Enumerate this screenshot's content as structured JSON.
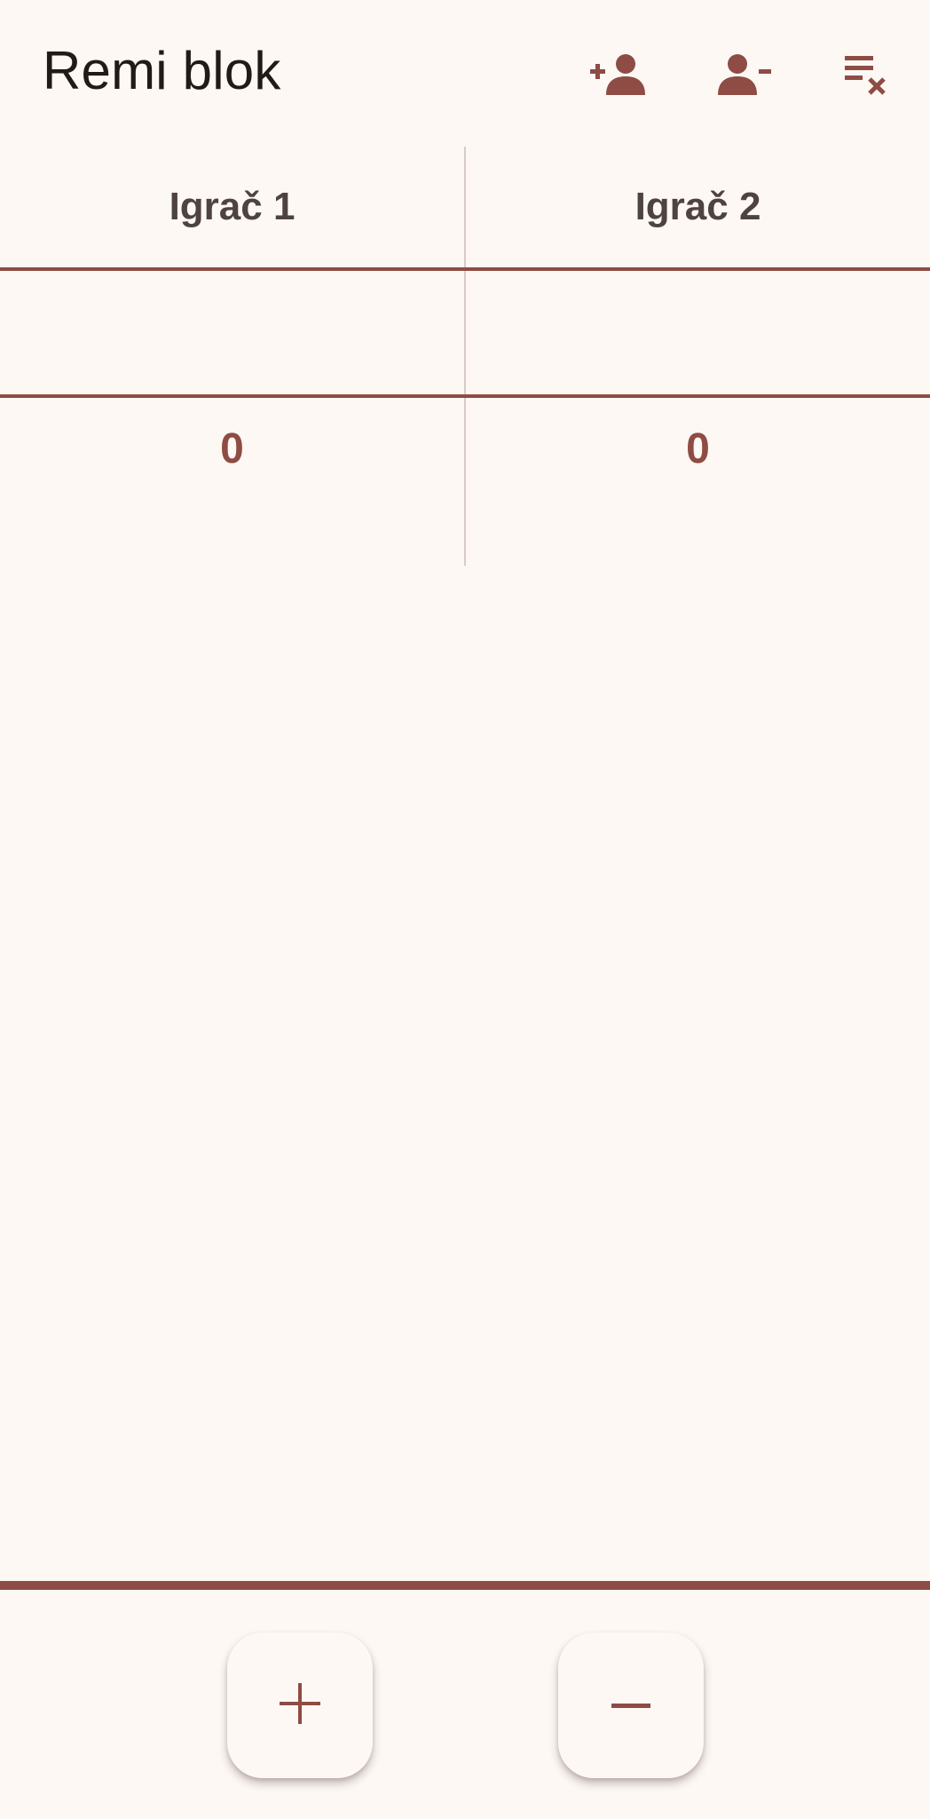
{
  "app": {
    "title": "Remi blok"
  },
  "toolbar": {
    "actions": [
      {
        "name": "add-player",
        "icon": "person-add-icon"
      },
      {
        "name": "remove-player",
        "icon": "person-remove-icon"
      },
      {
        "name": "clear-list",
        "icon": "clear-list-icon"
      }
    ]
  },
  "table": {
    "players": [
      {
        "name": "Igrač 1",
        "total": "0"
      },
      {
        "name": "Igrač 2",
        "total": "0"
      }
    ]
  },
  "fabs": {
    "add": {
      "icon": "plus-icon"
    },
    "subtract": {
      "icon": "minus-icon"
    }
  },
  "colors": {
    "accent": "#8e4c44",
    "background": "#fdf8f4",
    "header_text": "#4e4341",
    "title_text": "#221a17",
    "divider": "#d9cbc6"
  }
}
